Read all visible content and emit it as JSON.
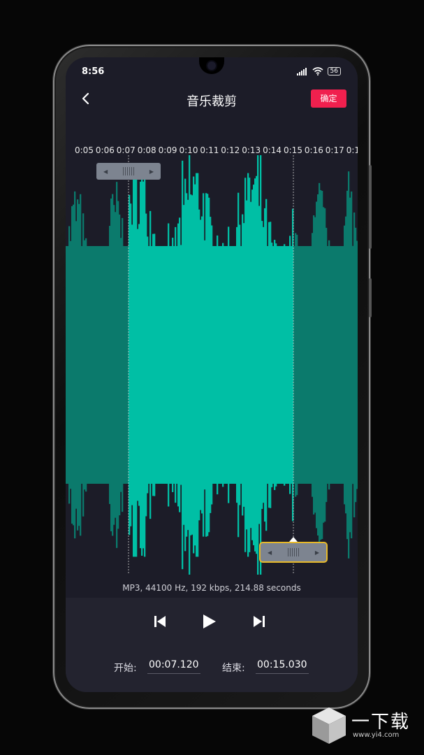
{
  "status_bar": {
    "time": "8:56",
    "battery": "56"
  },
  "header": {
    "title": "音乐裁剪",
    "confirm_label": "确定"
  },
  "timeline": {
    "ticks": [
      "0:05",
      "0:06",
      "0:07",
      "0:08",
      "0:09",
      "0:10",
      "0:11",
      "0:12",
      "0:13",
      "0:14",
      "0:15",
      "0:16",
      "0:17",
      "0:1"
    ]
  },
  "audio_info": "MP3, 44100 Hz, 192 kbps, 214.88 seconds",
  "fields": {
    "start_label": "开始:",
    "start_value": "00:07.120",
    "end_label": "结束:",
    "end_value": "00:15.030"
  },
  "watermark": {
    "brand": "一下载",
    "url": "www.yi4.com"
  },
  "colors": {
    "waveform_selected": "#00bfa5",
    "waveform_unselected": "#0b7a6c",
    "confirm_button": "#f0204e",
    "end_handle_border": "#e7b92a"
  }
}
